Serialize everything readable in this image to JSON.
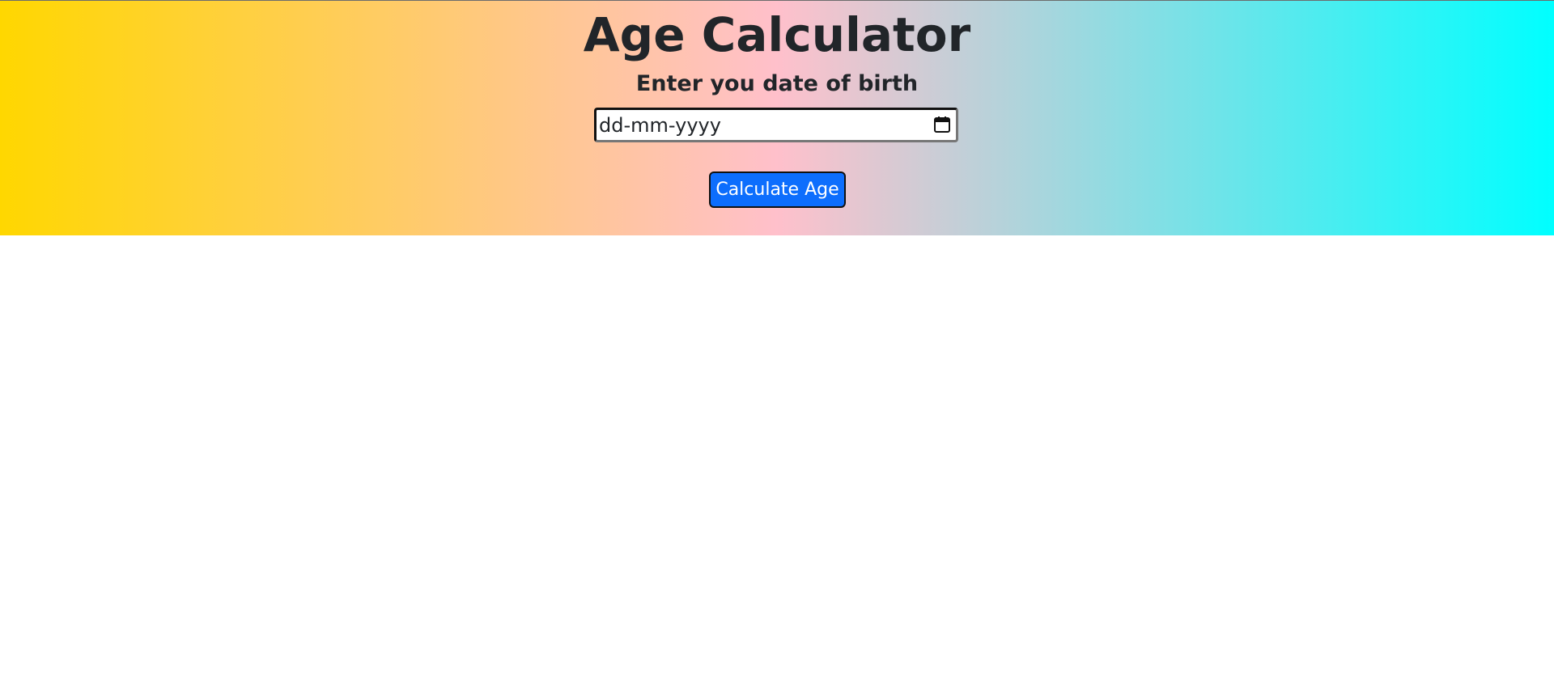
{
  "header": {
    "title": "Age Calculator",
    "subtitle": "Enter you date of birth"
  },
  "dob_input": {
    "value": "",
    "placeholder": "dd-mm-yyyy",
    "icon": "calendar-icon"
  },
  "actions": {
    "calculate_label": "Calculate Age"
  },
  "theme": {
    "gradient_start": "#ffd700",
    "gradient_mid": "#ffc0cb",
    "gradient_end": "#00ffff",
    "button_color": "#0d6efd",
    "text_color": "#212529"
  }
}
